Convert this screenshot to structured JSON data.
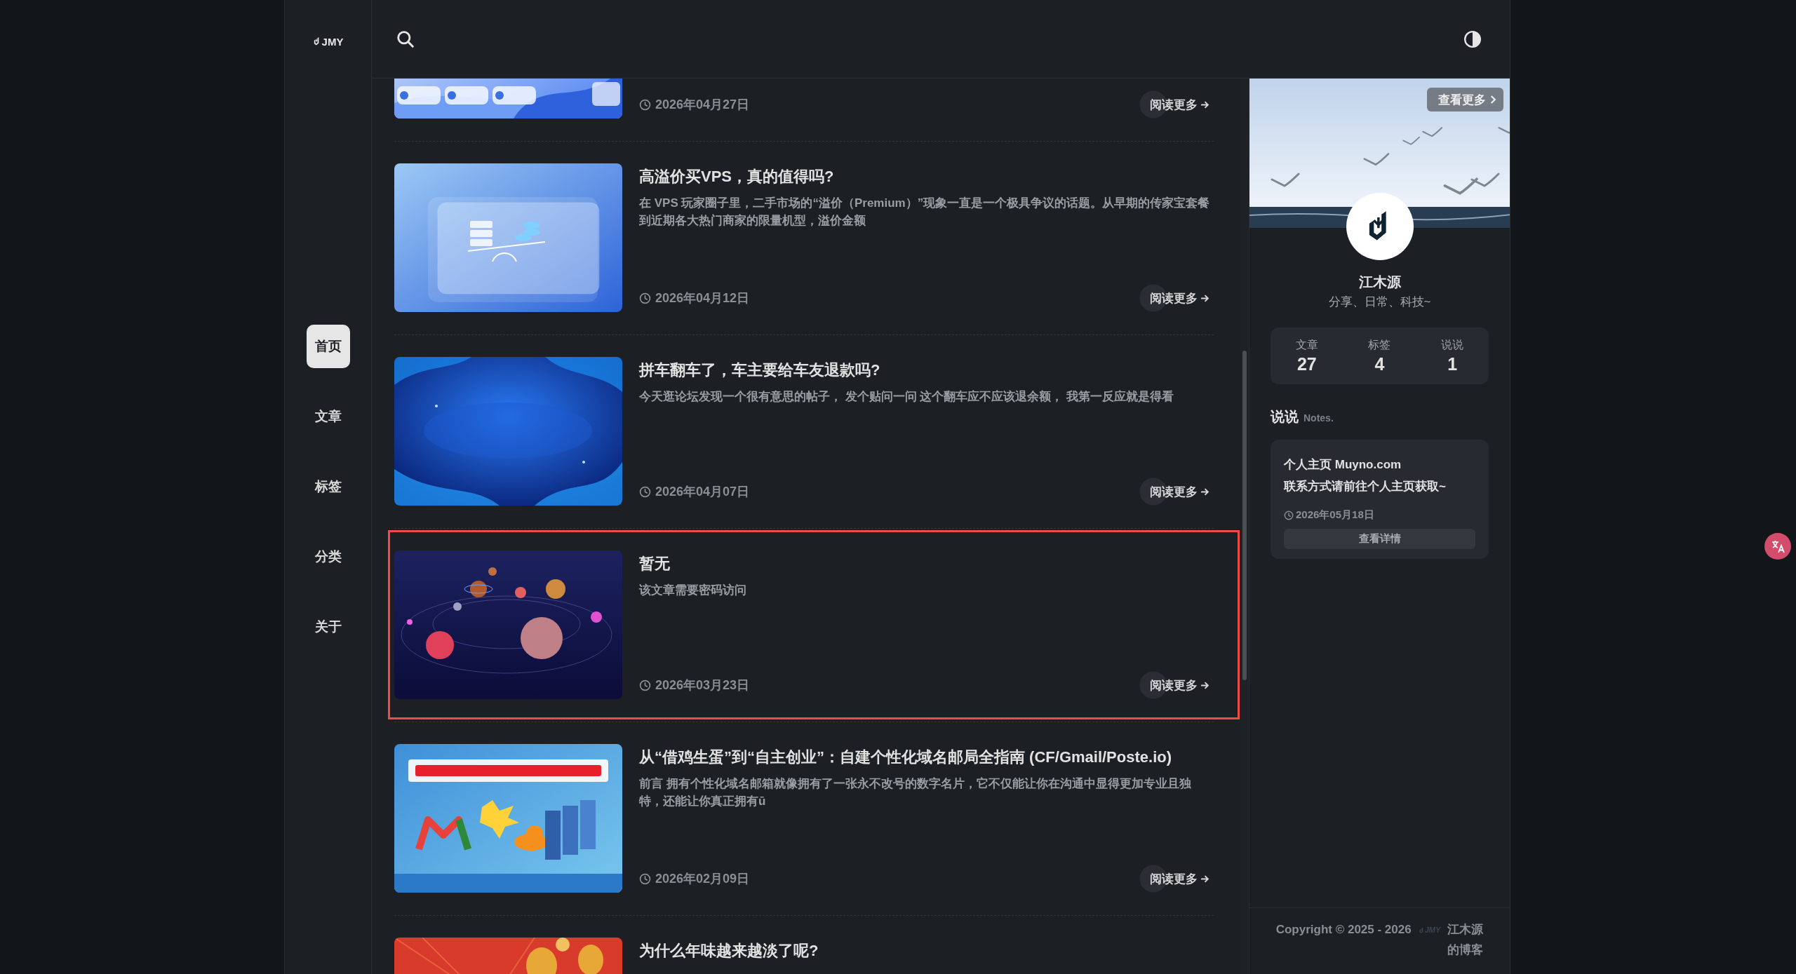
{
  "header": {
    "logo": "JMY"
  },
  "nav": [
    {
      "label": "首页",
      "selected": true
    },
    {
      "label": "文章",
      "selected": false
    },
    {
      "label": "标签",
      "selected": false
    },
    {
      "label": "分类",
      "selected": false
    },
    {
      "label": "关于",
      "selected": false
    }
  ],
  "posts": [
    {
      "date": "2026年04月27日",
      "read_more": "阅读更多",
      "highlighted": false
    },
    {
      "title": "高溢价买VPS，真的值得吗?",
      "excerpt": "在 VPS 玩家圈子里，二手市场的“溢价（Premium）”现象一直是一个极具争议的话题。从早期的传家宝套餐到近期各大热门商家的限量机型，溢价金额",
      "date": "2026年04月12日",
      "read_more": "阅读更多",
      "highlighted": false
    },
    {
      "title": "拼车翻车了，车主要给车友退款吗?",
      "excerpt": "今天逛论坛发现一个很有意思的帖子， 发个贴问一问 这个翻车应不应该退余额， 我第一反应就是得看",
      "date": "2026年04月07日",
      "read_more": "阅读更多",
      "highlighted": false
    },
    {
      "title": "暂无",
      "excerpt": "该文章需要密码访问",
      "date": "2026年03月23日",
      "read_more": "阅读更多",
      "highlighted": true
    },
    {
      "title": "从“借鸡生蛋”到“自主创业”：自建个性化域名邮局全指南 (CF/Gmail/Poste.io)",
      "excerpt": "前言 拥有个性化域名邮箱就像拥有了一张永不改号的数字名片，它不仅能让你在沟通中显得更加专业且独特，还能让你真正拥有ū",
      "date": "2026年02月09日",
      "read_more": "阅读更多",
      "highlighted": false
    },
    {
      "title": "为什么年味越来越淡了呢?",
      "highlighted": false
    }
  ],
  "sidebar": {
    "more_button": "查看更多",
    "name": "江木源",
    "bio": "分享、日常、科技~",
    "stats": [
      {
        "label": "文章",
        "value": "27"
      },
      {
        "label": "标签",
        "value": "4"
      },
      {
        "label": "说说",
        "value": "1"
      }
    ],
    "notes": {
      "title": "说说",
      "subtitle": "Notes.",
      "items": [
        {
          "lines": [
            "个人主页 Muyno.com",
            "联系方式请前往个人主页获取~"
          ],
          "date": "2026年05月18日",
          "button": "查看详情"
        }
      ]
    }
  },
  "footer": {
    "copyright": "Copyright © 2025 - 2026",
    "logo": "JMY",
    "site": "江木源的博客"
  }
}
